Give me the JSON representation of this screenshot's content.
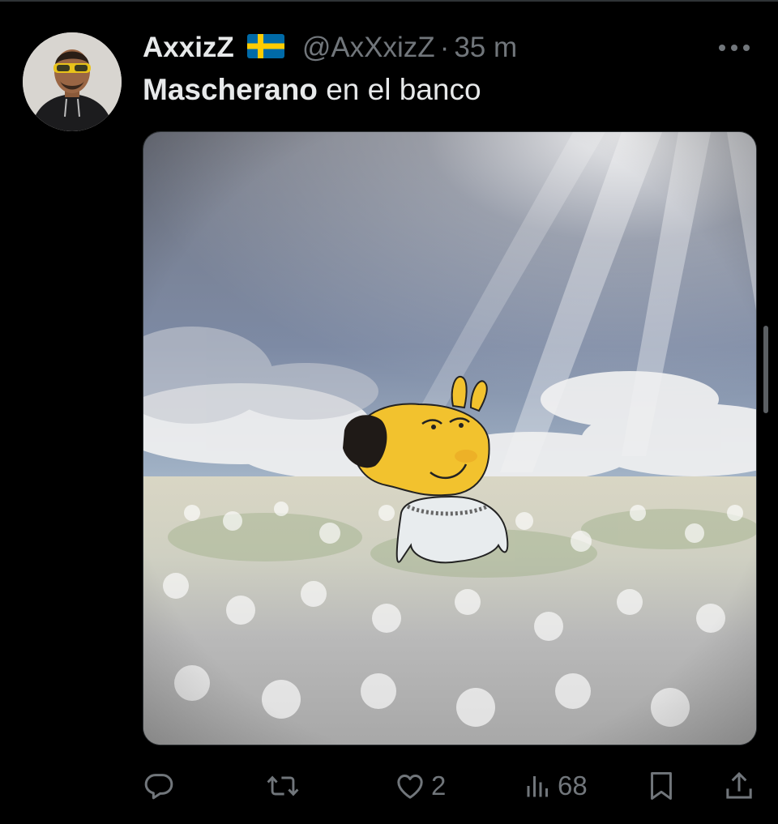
{
  "tweet": {
    "author_name": "AxxizZ",
    "flag_icon": "sweden-flag-icon",
    "handle": "@AxXxizZ",
    "separator": "·",
    "time": "35 m",
    "text_bold": "Mascherano",
    "text_rest": " en el banco"
  },
  "actions": {
    "reply": {
      "icon": "reply-icon",
      "count": ""
    },
    "retweet": {
      "icon": "retweet-icon",
      "count": ""
    },
    "like": {
      "icon": "heart-icon",
      "count": "2"
    },
    "views": {
      "icon": "views-icon",
      "count": "68"
    },
    "bookmark": {
      "icon": "bookmark-icon"
    },
    "share": {
      "icon": "share-icon"
    }
  },
  "colors": {
    "background": "#000000",
    "text": "#e7e9ea",
    "muted": "#71767b",
    "divider": "#2f3336",
    "flag_blue": "#006aa7",
    "flag_yellow": "#fecc00"
  }
}
